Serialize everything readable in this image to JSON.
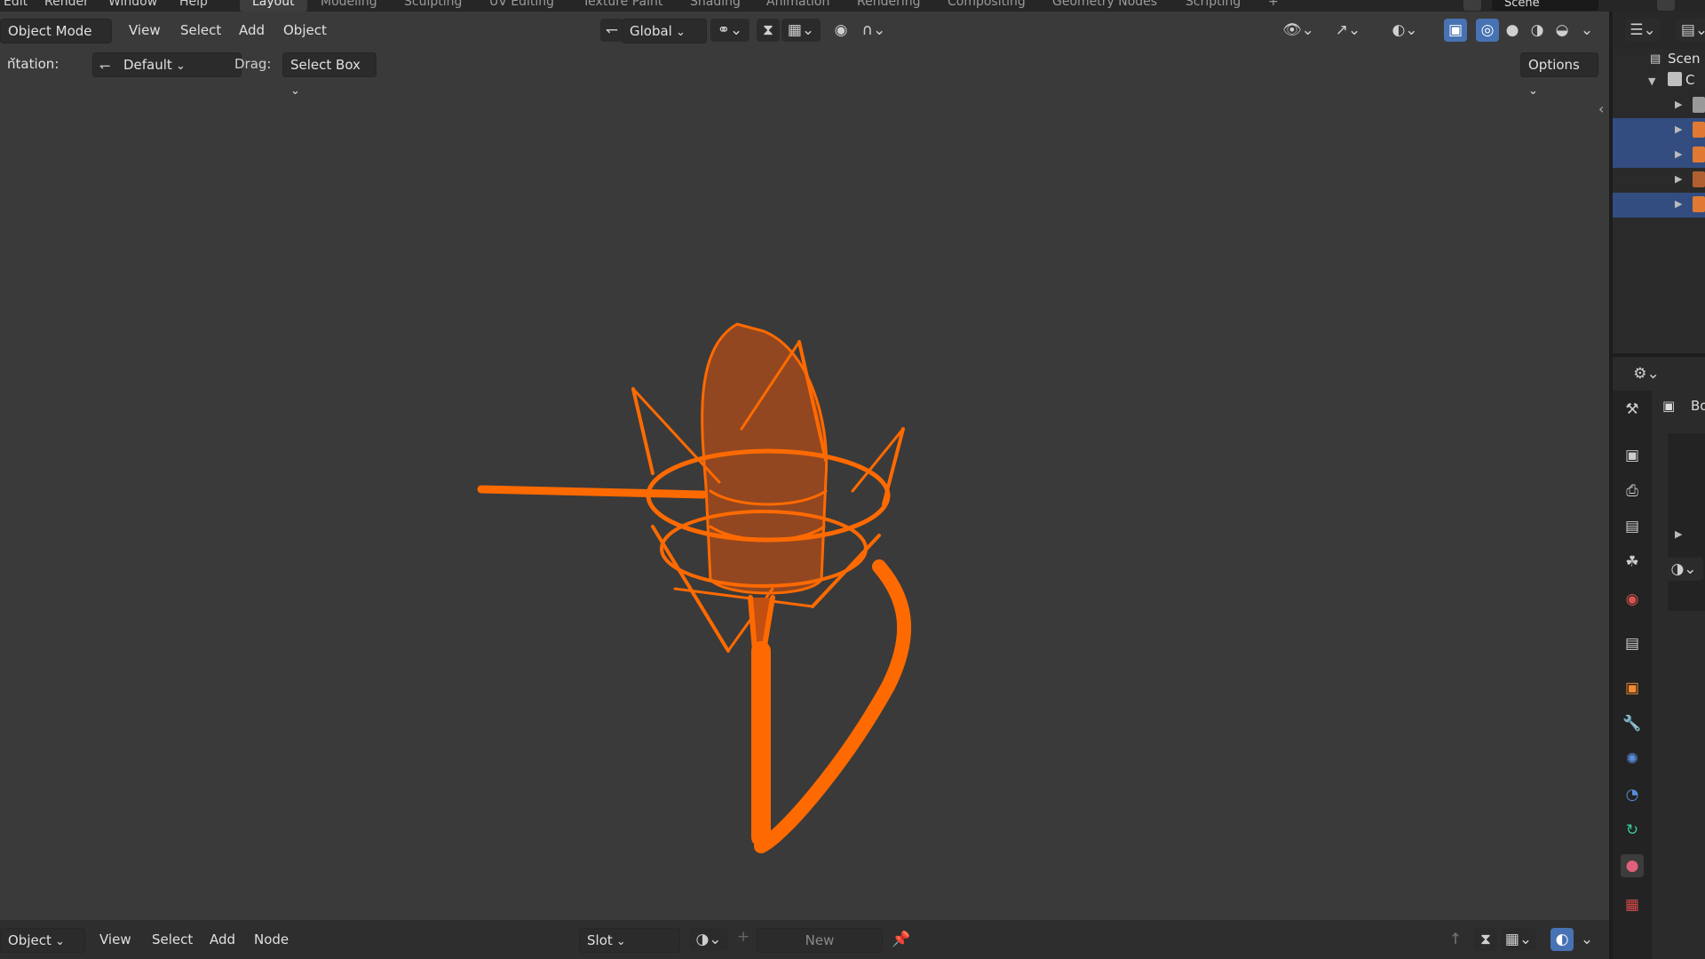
{
  "topbar": {
    "menus": [
      "Edit",
      "Render",
      "Window",
      "Help"
    ],
    "workspaces": [
      "Layout",
      "Modeling",
      "Sculpting",
      "UV Editing",
      "Texture Paint",
      "Shading",
      "Animation",
      "Rendering",
      "Compositing",
      "Geometry Nodes",
      "Scripting",
      "+"
    ],
    "active_workspace": "Layout",
    "scene_label": "Scene"
  },
  "viewport_header": {
    "mode": "Object Mode",
    "menus": [
      "View",
      "Select",
      "Add",
      "Object"
    ],
    "transform_orientation": "Global"
  },
  "tool_header": {
    "orientation_label": "ntation:",
    "orientation_value": "Default",
    "drag_label": "Drag:",
    "drag_value": "Select Box",
    "options": "Options"
  },
  "outliner": {
    "header_label": "Scen",
    "collection_label": "C",
    "rows_selected": [
      false,
      true,
      true,
      false,
      true
    ]
  },
  "properties": {
    "object_label": "Bo",
    "tabs": [
      "tool-icon",
      "render-icon",
      "output-icon",
      "view-layer-icon",
      "scene-icon",
      "world-icon",
      "collection-icon",
      "object-icon",
      "modifier-icon",
      "particles-icon",
      "physics-icon",
      "constraints-icon",
      "material-icon",
      "texture-icon"
    ]
  },
  "footer": {
    "mode": "Object",
    "menus": [
      "View",
      "Select",
      "Add",
      "Node"
    ],
    "slot": "Slot",
    "new_label": "New"
  },
  "colors": {
    "viewport_bg": "#3a3a3a",
    "selection_orange": "#ff6a00",
    "accent_blue": "#4772b3"
  }
}
